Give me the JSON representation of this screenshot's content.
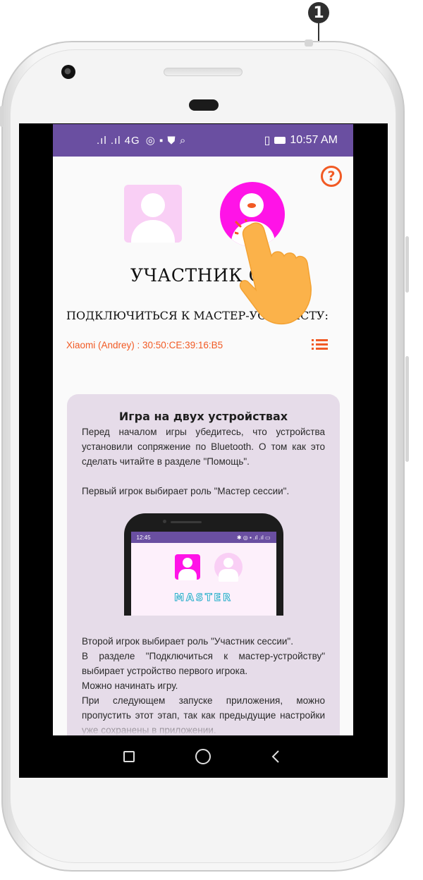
{
  "callout": {
    "number": "1"
  },
  "statusbar": {
    "signal_text": ".ıl .ıl 4G",
    "left_icons": "◎ ▪ ⛊ ⌕",
    "vibrate_icon": "▯",
    "time": "10:57 AM"
  },
  "help": {
    "glyph": "?"
  },
  "screen": {
    "role_title": "УЧАСТНИК СЕ",
    "connect_label": "ПОДКЛЮЧИТЬСЯ К МАСТЕР-УСТРОЙСТ",
    "connect_label_tail": "У:",
    "device": "Xiaomi (Andrey) : 30:50:CE:39:16:B5"
  },
  "card": {
    "title": "Игра на двух устройствах",
    "p1": "Перед началом игры убедитесь, что устройства установили сопряжение по Bluetooth. О том как это сделать читайте в разделе \"Помощь\".",
    "p2": "Первый игрок выбирает роль \"Мастер сессии\".",
    "p3_line1": "Второй игрок выбирает роль \"Участник сессии\".",
    "p3_line2": "В разделе \"Подключиться к мастер-устройству\" выбирает устройство первого игрока.",
    "p3_line3": "Можно начинать игру.",
    "p3_line4": "При следующем запуске приложения, можно пропустить этот этап, так как предыдущие настройки уже сохранены в приложении."
  },
  "mini_phone": {
    "time": "12:45",
    "status_right": "✱ ◎ ▪ .ıl .ıl ▭",
    "master_label": "MASTER"
  },
  "colors": {
    "accent": "#f15a24",
    "statusbar": "#6a4fa1",
    "magenta": "#ff13e7",
    "pink_light": "#f9cff5",
    "card_bg": "#e6dce9"
  }
}
